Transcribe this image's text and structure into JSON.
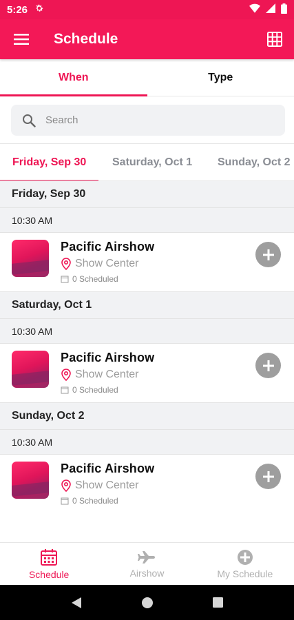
{
  "status_bar": {
    "time": "5:26"
  },
  "app_bar": {
    "title": "Schedule"
  },
  "top_tabs": [
    {
      "label": "When",
      "active": true
    },
    {
      "label": "Type",
      "active": false
    }
  ],
  "search": {
    "placeholder": "Search",
    "value": ""
  },
  "date_tabs": [
    {
      "label": "Friday, Sep 30",
      "active": true
    },
    {
      "label": "Saturday, Oct 1",
      "active": false
    },
    {
      "label": "Sunday, Oct 2",
      "active": false
    }
  ],
  "days": [
    {
      "day": "Friday, Sep 30",
      "time": "10:30 AM",
      "event": {
        "name": "Pacific Airshow",
        "location": "Show Center",
        "scheduled": "0 Scheduled"
      }
    },
    {
      "day": "Saturday, Oct 1",
      "time": "10:30 AM",
      "event": {
        "name": "Pacific Airshow",
        "location": "Show Center",
        "scheduled": "0 Scheduled"
      }
    },
    {
      "day": "Sunday, Oct 2",
      "time": "10:30 AM",
      "event": {
        "name": "Pacific Airshow",
        "location": "Show Center",
        "scheduled": "0 Scheduled"
      }
    }
  ],
  "bottom_nav": [
    {
      "label": "Schedule",
      "icon": "calendar-icon",
      "active": true
    },
    {
      "label": "Airshow",
      "icon": "airplane-icon",
      "active": false
    },
    {
      "label": "My Schedule",
      "icon": "plus-circle-icon",
      "active": false
    }
  ],
  "colors": {
    "accent": "#ee1654",
    "inactive": "#b0b0b0",
    "section_bg": "#f1f2f4"
  }
}
